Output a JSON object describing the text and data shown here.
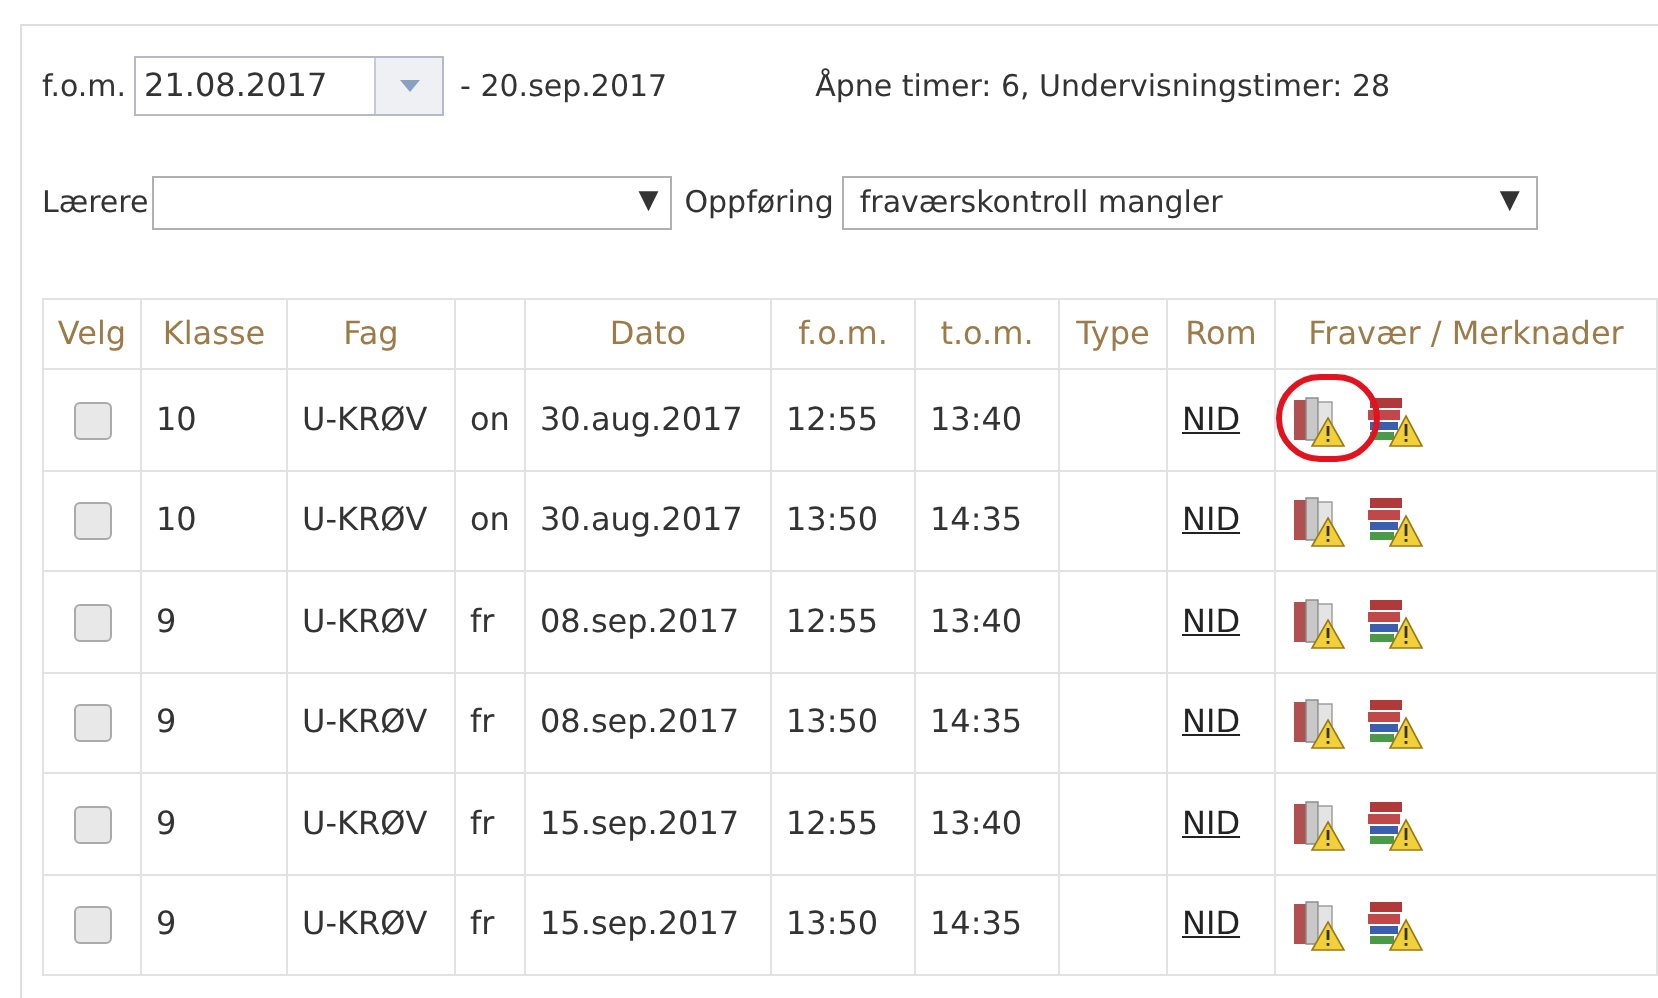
{
  "filters": {
    "from_label": "f.o.m.",
    "from_value": "21.08.2017",
    "to_text": "- 20.sep.2017",
    "summary": "Åpne timer: 6, Undervisningstimer: 28",
    "teacher_label": "Lærere",
    "teacher_arrow": "▼",
    "status_label": "Oppføring",
    "status_value": "fraværskontroll mangler",
    "status_arrow": "▼"
  },
  "table": {
    "columns": [
      "Velg",
      "Klasse",
      "Fag",
      "",
      "Dato",
      "f.o.m.",
      "t.o.m.",
      "Type",
      "Rom",
      "Fravær / Merknader"
    ],
    "rows": [
      {
        "checked": false,
        "klasse": "10",
        "fag": "U-KRØV",
        "day": "on",
        "dato": "30.aug.2017",
        "fom": "12:55",
        "tom": "13:40",
        "rom": "NID",
        "highlighted": true
      },
      {
        "checked": false,
        "klasse": "10",
        "fag": "U-KRØV",
        "day": "on",
        "dato": "30.aug.2017",
        "fom": "13:50",
        "tom": "14:35",
        "rom": "NID",
        "highlighted": false
      },
      {
        "checked": false,
        "klasse": "9",
        "fag": "U-KRØV",
        "day": "fr",
        "dato": "08.sep.2017",
        "fom": "12:55",
        "tom": "13:40",
        "rom": "NID",
        "highlighted": false
      },
      {
        "checked": false,
        "klasse": "9",
        "fag": "U-KRØV",
        "day": "fr",
        "dato": "08.sep.2017",
        "fom": "13:50",
        "tom": "14:35",
        "rom": "NID",
        "highlighted": false
      },
      {
        "checked": false,
        "klasse": "9",
        "fag": "U-KRØV",
        "day": "fr",
        "dato": "15.sep.2017",
        "fom": "12:55",
        "tom": "13:40",
        "rom": "NID",
        "highlighted": false
      },
      {
        "checked": false,
        "klasse": "9",
        "fag": "U-KRØV",
        "day": "fr",
        "dato": "15.sep.2017",
        "fom": "13:50",
        "tom": "14:35",
        "rom": "NID",
        "highlighted": false
      }
    ]
  }
}
